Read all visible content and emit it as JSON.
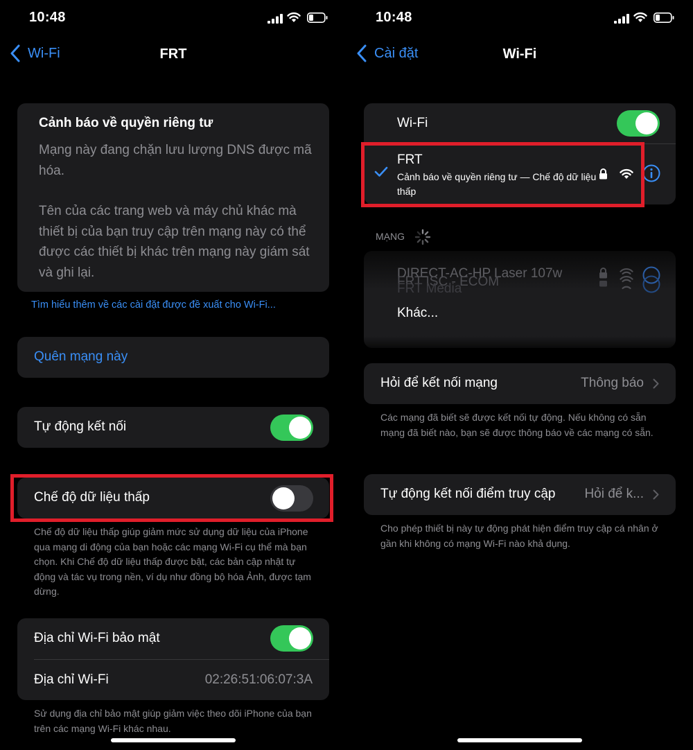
{
  "status_bar": {
    "time": "10:48"
  },
  "left": {
    "nav": {
      "back_label": "Wi-Fi",
      "title": "FRT"
    },
    "privacy_card": {
      "title": "Cảnh báo về quyền riêng tư",
      "body1": "Mạng này đang chặn lưu lượng DNS được mã hóa.",
      "body2": "Tên của các trang web và máy chủ khác mà thiết bị của bạn truy cập trên mạng này có thể được các thiết bị khác trên mạng này giám sát và ghi lại."
    },
    "learn_more_link": "Tìm hiểu thêm về các cài đặt được đề xuất cho Wi-Fi...",
    "forget_network": "Quên mạng này",
    "auto_join": {
      "label": "Tự động kết nối",
      "on": true
    },
    "low_data": {
      "label": "Chế độ dữ liệu thấp",
      "on": false,
      "footer": "Chế độ dữ liệu thấp giúp giảm mức sử dụng dữ liệu của iPhone qua mạng di động của bạn hoặc các mạng Wi-Fi cụ thể mà bạn chọn. Khi Chế độ dữ liệu thấp được bật, các bản cập nhật tự động và tác vụ trong nền, ví dụ như đồng bộ hóa Ảnh, được tạm dừng."
    },
    "private_address": {
      "label": "Địa chỉ Wi-Fi bảo mật",
      "on": true
    },
    "wifi_address": {
      "label": "Địa chỉ Wi-Fi",
      "value": "02:26:51:06:07:3A"
    },
    "private_footer": "Sử dụng địa chỉ bảo mật giúp giảm việc theo dõi iPhone của bạn trên các mạng Wi-Fi khác nhau."
  },
  "right": {
    "nav": {
      "back_label": "Cài đặt",
      "title": "Wi-Fi"
    },
    "wifi_toggle": {
      "label": "Wi-Fi",
      "on": true
    },
    "connected": {
      "name": "FRT",
      "subtitle": "Cảnh báo về quyền riêng tư — Chế độ dữ liệu thấp"
    },
    "networks_header": "MẠNG",
    "networks": [
      "DIRECT-AC-HP Laser 107w",
      "FRT ISC - ECOM",
      "FRT Media"
    ],
    "other": "Khác...",
    "ask_join": {
      "label": "Hỏi để kết nối mạng",
      "value": "Thông báo"
    },
    "ask_join_footer": "Các mạng đã biết sẽ được kết nối tự động. Nếu không có sẵn mạng đã biết nào, bạn sẽ được thông báo về các mạng có sẵn.",
    "auto_hotspot": {
      "label": "Tự động kết nối điểm truy cập",
      "value": "Hỏi để k..."
    },
    "auto_hotspot_footer": "Cho phép thiết bị này tự động phát hiện điểm truy cập cá nhân ở gần khi không có mạng Wi-Fi nào khả dụng."
  },
  "colors": {
    "accent": "#3a8ff7",
    "toggle_on": "#34c759",
    "highlight": "#e01e2a"
  }
}
